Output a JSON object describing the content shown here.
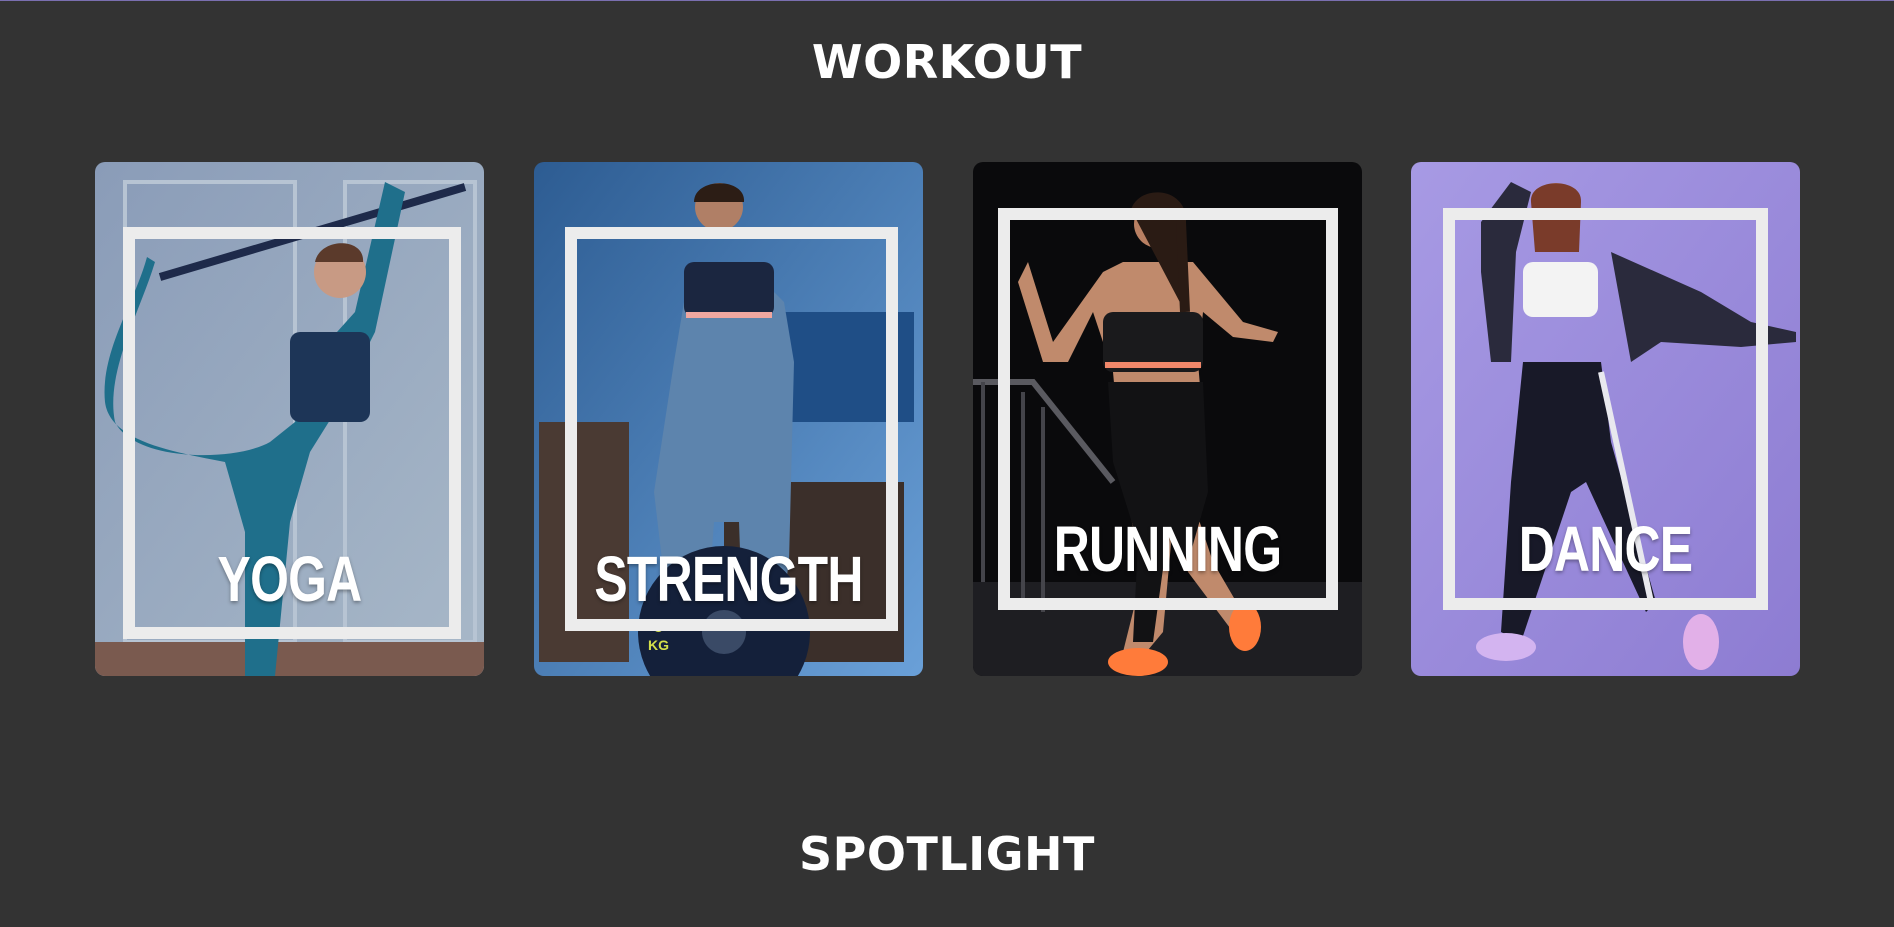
{
  "workout": {
    "title": "WORKOUT",
    "cards": [
      {
        "label": "YOGA",
        "bg": "#7f93ad",
        "accent": "#1f6f8b"
      },
      {
        "label": "STRENGTH",
        "bg": "#3f78b5",
        "accent": "#5a86b0"
      },
      {
        "label": "RUNNING",
        "bg": "#0d0d0f",
        "accent": "#ff7b3a"
      },
      {
        "label": "DANCE",
        "bg": "#9a8ad8",
        "accent": "#1c1d2c"
      }
    ]
  },
  "spotlight": {
    "title": "SPOTLIGHT"
  },
  "colors": {
    "page_bg": "#333333",
    "frame": "#ececec",
    "text": "#ffffff"
  }
}
